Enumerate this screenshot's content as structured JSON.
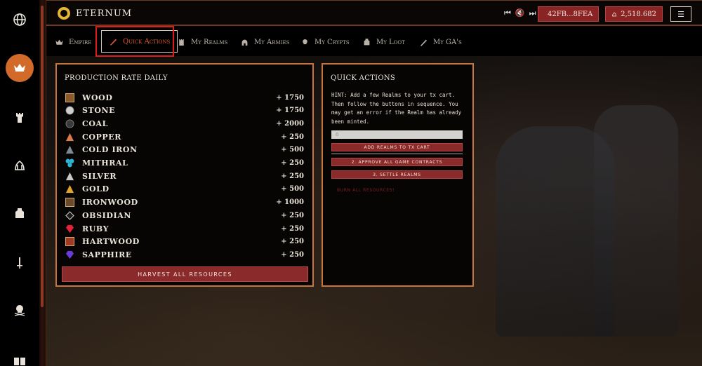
{
  "app": {
    "title": "ETERNUM"
  },
  "header": {
    "media": {
      "prev": "⏮",
      "mute": "🔇",
      "next": "⏭"
    },
    "wallet_address": "42FB...8FEA",
    "lords_balance": "2,518.682"
  },
  "tabs": [
    {
      "label": "Empire",
      "icon": "crown-icon",
      "active": false
    },
    {
      "label": "Quick Actions",
      "icon": "quill-icon",
      "active": true
    },
    {
      "label": "My Realms",
      "icon": "castle-icon",
      "active": false
    },
    {
      "label": "My Armies",
      "icon": "helmet-icon",
      "active": false
    },
    {
      "label": "My Crypts",
      "icon": "skull-icon",
      "active": false
    },
    {
      "label": "My Loot",
      "icon": "armor-icon",
      "active": false
    },
    {
      "label": "My GA's",
      "icon": "sword-icon",
      "active": false
    }
  ],
  "sidebar": {
    "items": [
      {
        "icon": "globe-icon",
        "active": false
      },
      {
        "icon": "crown-icon",
        "active": true
      },
      {
        "icon": "tower-icon",
        "active": false
      },
      {
        "icon": "lords-icon",
        "active": false
      },
      {
        "icon": "armor-icon",
        "active": false
      },
      {
        "icon": "sword-icon",
        "active": false
      },
      {
        "icon": "skull-icon",
        "active": false
      },
      {
        "icon": "book-icon",
        "active": false
      }
    ]
  },
  "production": {
    "title": "PRODUCTION RATE DAILY",
    "resources": [
      {
        "name": "WOOD",
        "rate": "+ 1750",
        "color": "#8a5a2b",
        "shape": "square"
      },
      {
        "name": "STONE",
        "rate": "+ 1750",
        "color": "#cfcfcf",
        "shape": "circle"
      },
      {
        "name": "COAL",
        "rate": "+ 2000",
        "color": "#3a3a3a",
        "shape": "circle"
      },
      {
        "name": "COPPER",
        "rate": "+ 250",
        "color": "#d97b4a",
        "shape": "triangle"
      },
      {
        "name": "COLD IRON",
        "rate": "+ 500",
        "color": "#7d8a94",
        "shape": "triangle"
      },
      {
        "name": "MITHRAL",
        "rate": "+ 250",
        "color": "#2bb6d6",
        "shape": "cluster"
      },
      {
        "name": "SILVER",
        "rate": "+ 250",
        "color": "#c8c8c8",
        "shape": "triangle"
      },
      {
        "name": "GOLD",
        "rate": "+ 500",
        "color": "#e2a42b",
        "shape": "triangle"
      },
      {
        "name": "IRONWOOD",
        "rate": "+ 1000",
        "color": "#6b4a2a",
        "shape": "square"
      },
      {
        "name": "OBSIDIAN",
        "rate": "+ 250",
        "color": "#1c1c1c",
        "shape": "diamond"
      },
      {
        "name": "RUBY",
        "rate": "+ 250",
        "color": "#e0233a",
        "shape": "gem"
      },
      {
        "name": "HARTWOOD",
        "rate": "+ 250",
        "color": "#a13a22",
        "shape": "square"
      },
      {
        "name": "SAPPHIRE",
        "rate": "+ 250",
        "color": "#6a3ad6",
        "shape": "gem"
      }
    ],
    "harvest_label": "HARVEST ALL RESOURCES"
  },
  "quick_actions": {
    "title": "QUICK ACTIONS",
    "hint": "HINT: Add a few Realms to your tx cart. Then follow the buttons in sequence. You may get an error if the Realm has already been minted.",
    "input_value": "0",
    "add_label": "ADD REALMS TO TX CART",
    "approve_label": "2. APPROVE ALL GAME CONTRACTS",
    "settle_label": "3. SETTLE REALMS",
    "burn_label": "BURN ALL RESOURCES!"
  },
  "colors": {
    "accent": "#c8743b",
    "button": "#8a2a2a",
    "active_tab": "#e15a2a"
  }
}
